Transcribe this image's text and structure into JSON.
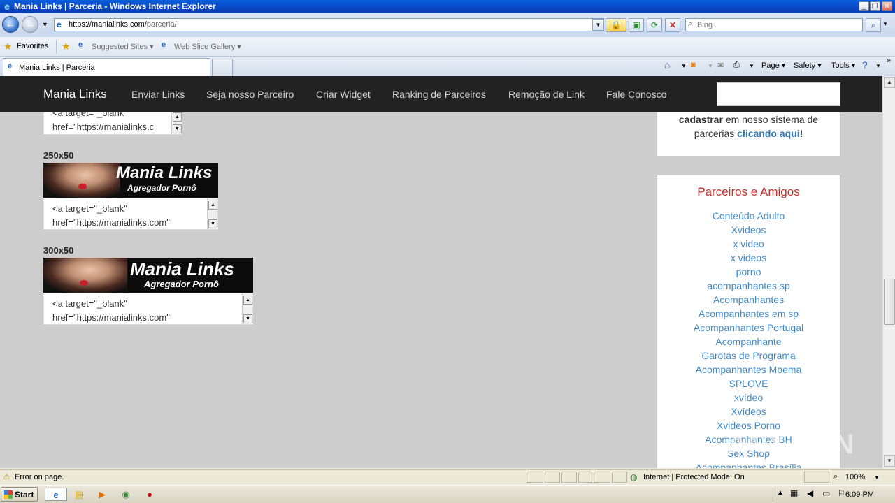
{
  "window": {
    "title": "Mania Links | Parceria - Windows Internet Explorer",
    "caption_buttons": [
      "_",
      "❐",
      "✕"
    ]
  },
  "address_bar": {
    "url_host": "https://manialinks.com/",
    "url_path": "parceria/"
  },
  "search_box": {
    "placeholder": "Bing"
  },
  "favorites_bar": {
    "favorites": "Favorites",
    "suggested_sites": "Suggested Sites",
    "web_slice_gallery": "Web Slice Gallery"
  },
  "tab": {
    "title": "Mania Links | Parceria"
  },
  "command_bar": {
    "page": "Page",
    "safety": "Safety",
    "tools": "Tools"
  },
  "site_nav": {
    "brand": "Mania Links",
    "links": [
      "Enviar Links",
      "Seja nosso Parceiro",
      "Criar Widget",
      "Ranking de Parceiros",
      "Remoção de Link",
      "Fale Conosco"
    ]
  },
  "banners": [
    {
      "code_lines": [
        "<a target=\"_blank\"",
        "href=\"https://manialinks.c"
      ]
    },
    {
      "label": "250x50",
      "banner_title": "Mania Links",
      "banner_subtitle": "Agregador Pornô",
      "code_lines": [
        "<a target=\"_blank\"",
        "href=\"https://manialinks.com\""
      ]
    },
    {
      "label": "300x50",
      "banner_title": "Mania Links",
      "banner_subtitle": "Agregador Pornô",
      "code_lines": [
        "<a target=\"_blank\"",
        "href=\"https://manialinks.com\""
      ]
    }
  ],
  "sidebar": {
    "register": {
      "bold": "cadastrar",
      "text1": "em nosso sistema de",
      "text2": "parcerias",
      "link": "clicando aqui",
      "end": "!"
    },
    "parceiros_title": "Parceiros e Amigos",
    "parceiros_links": [
      "Conteúdo Adulto",
      "Xvideos",
      "x video",
      "x videos",
      "porno",
      "acompanhantes sp",
      "Acompanhantes",
      "Acompanhantes em sp",
      "Acompanhantes Portugal",
      "Acompanhante",
      "Garotas de Programa",
      "Acompanhantes Moema",
      "SPLOVE",
      "xvídeo",
      "Xvídeos",
      "Xvideos Porno",
      "Acompanhantes BH",
      "Sex Shop",
      "Acompanhantes Brasília"
    ]
  },
  "status_bar": {
    "message": "Error on page.",
    "zone": "Internet | Protected Mode: On",
    "zoom": "100%"
  },
  "taskbar": {
    "start": "Start",
    "clock": "6:09 PM"
  },
  "watermark": "ANY RUN"
}
